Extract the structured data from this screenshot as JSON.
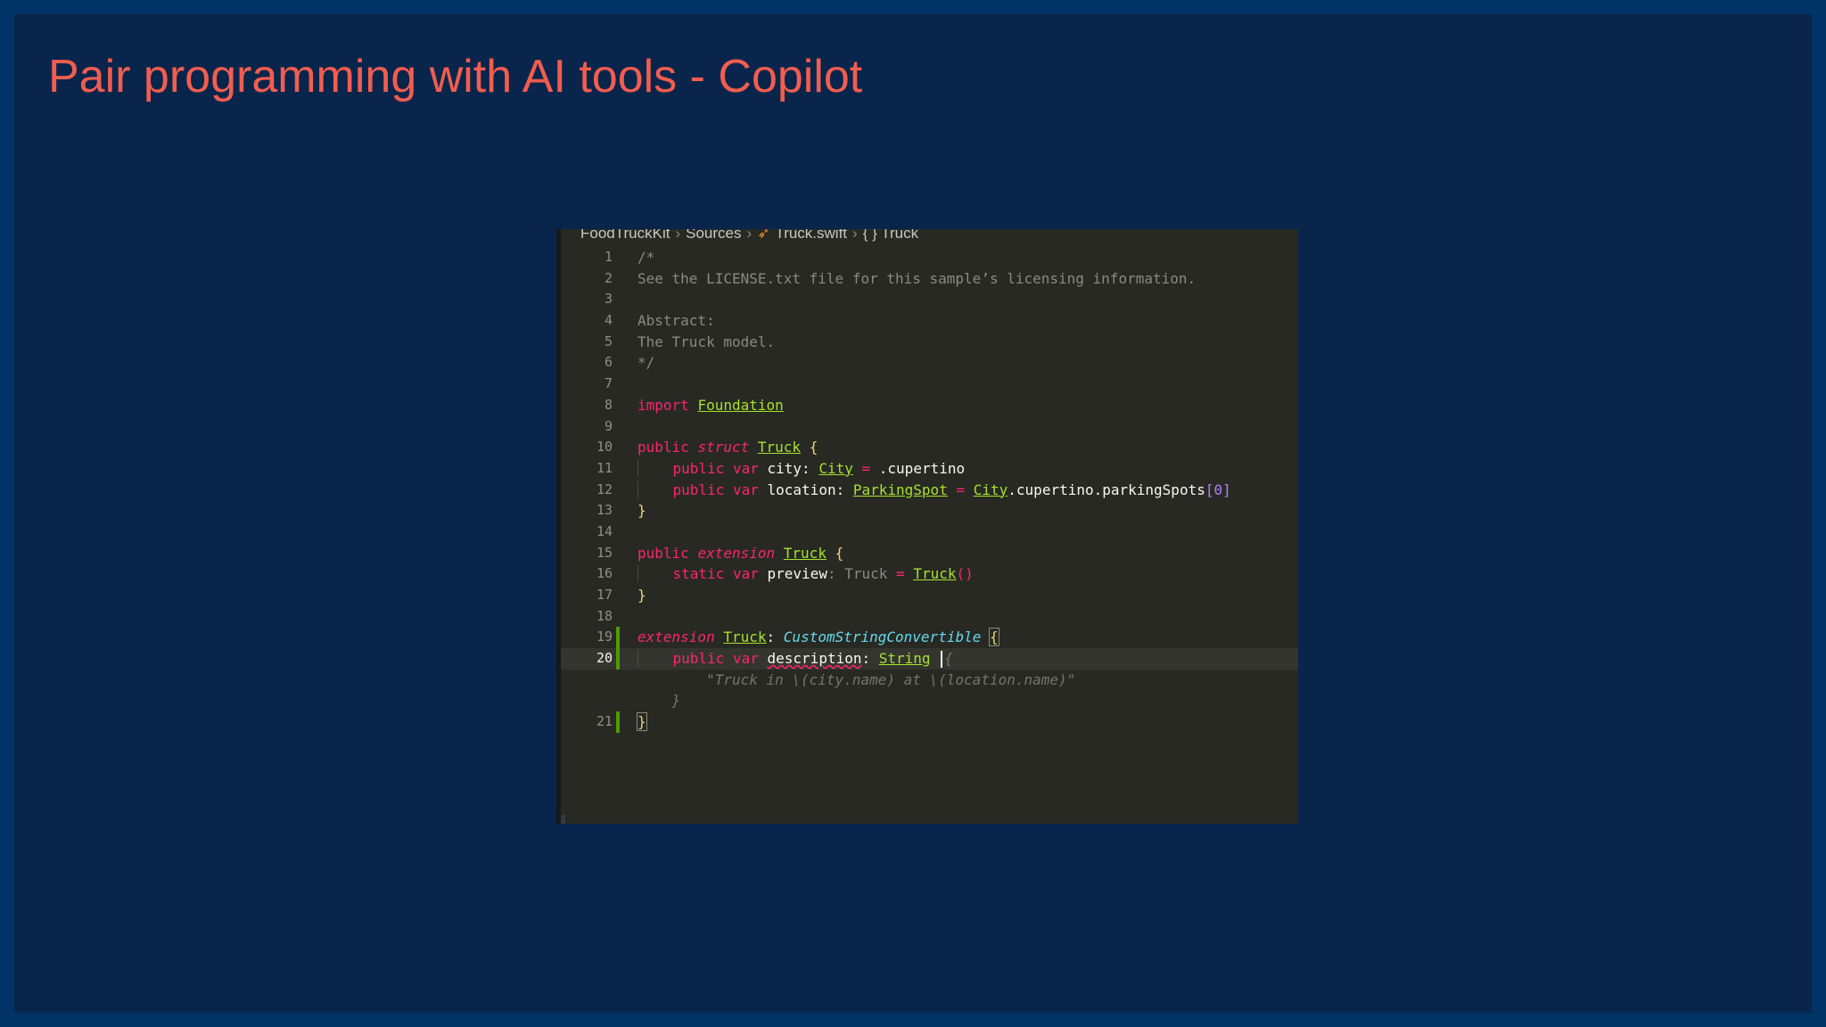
{
  "slide": {
    "title": "Pair programming with AI tools - Copilot"
  },
  "editor": {
    "breadcrumb": {
      "project": "FoodTruckKit",
      "folder": "Sources",
      "file": "Truck.swift",
      "symbol_icon": "{ }",
      "symbol": "Truck",
      "separator": "›"
    },
    "lines": {
      "1": "1",
      "2": "2",
      "3": "3",
      "4": "4",
      "5": "5",
      "6": "6",
      "7": "7",
      "8": "8",
      "9": "9",
      "10": "10",
      "11": "11",
      "12": "12",
      "13": "13",
      "14": "14",
      "15": "15",
      "16": "16",
      "17": "17",
      "18": "18",
      "19": "19",
      "20": "20",
      "21": "21"
    },
    "code": {
      "comment_open": "/*",
      "license_line": "See the LICENSE.txt file for this sample’s licensing information.",
      "abstract_label": "Abstract:",
      "abstract_text": "The Truck model.",
      "comment_close": "*/",
      "kw_import": "import",
      "module": "Foundation",
      "kw_public": "public",
      "kw_struct": "struct",
      "kw_var": "var",
      "kw_extension": "extension",
      "kw_static": "static",
      "type_truck": "Truck",
      "type_city": "City",
      "type_parking": "ParkingSpot",
      "type_string": "String",
      "protocol": "CustomStringConvertible",
      "prop_city": "city",
      "prop_location": "location",
      "prop_preview": "preview",
      "prop_description": "description",
      "val_cupertino": ".cupertino",
      "member_chain": ".cupertino.parkingSpots",
      "index": "0",
      "ghost_open": "{",
      "ghost_body": "\"Truck in \\(city.name) at \\(location.name)\"",
      "ghost_close": "}"
    }
  }
}
